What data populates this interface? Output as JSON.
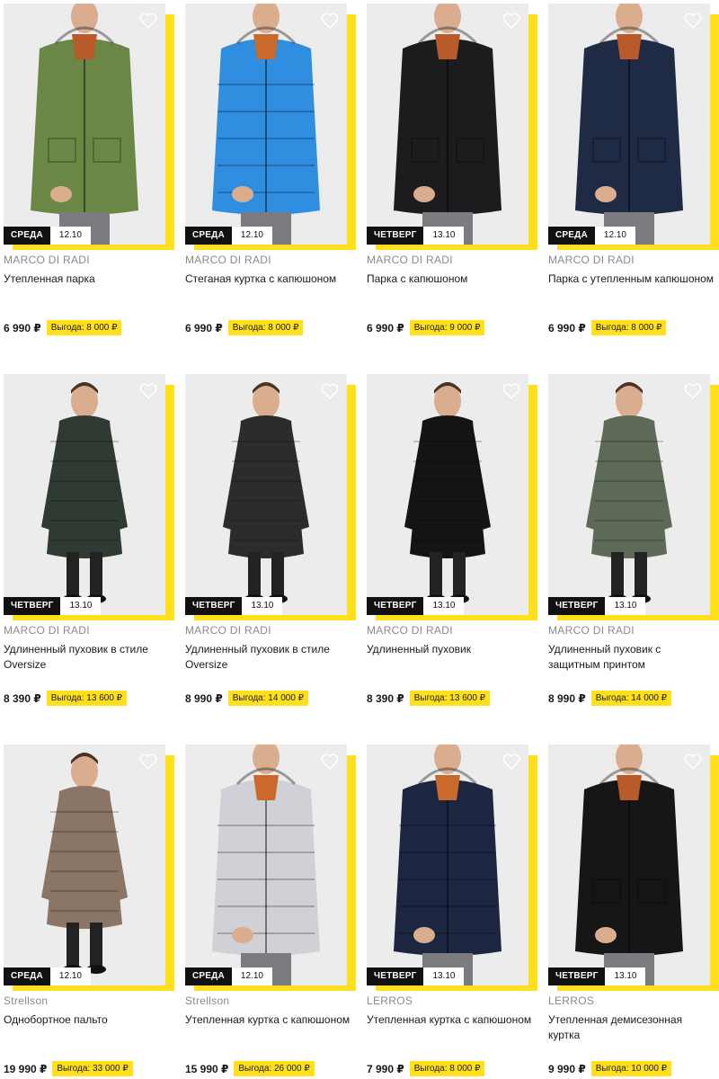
{
  "products": [
    {
      "brand": "MARCO DI RADI",
      "title": "Утепленная парка",
      "day": "СРЕДА",
      "date": "12.10",
      "price": "6 990 ₽",
      "benefit": "Выгода: 8 000 ₽",
      "coat_color": "#6b8745",
      "coat_shape": "parka"
    },
    {
      "brand": "MARCO DI RADI",
      "title": "Стеганая куртка с капюшоном",
      "day": "СРЕДА",
      "date": "12.10",
      "price": "6 990 ₽",
      "benefit": "Выгода: 8 000 ₽",
      "coat_color": "#2f8ee0",
      "coat_shape": "puffer"
    },
    {
      "brand": "MARCO DI RADI",
      "title": "Парка с капюшоном",
      "day": "ЧЕТВЕРГ",
      "date": "13.10",
      "price": "6 990 ₽",
      "benefit": "Выгода: 9 000 ₽",
      "coat_color": "#1c1c1e",
      "coat_shape": "parka"
    },
    {
      "brand": "MARCO DI RADI",
      "title": "Парка с утепленным капюшоном",
      "day": "СРЕДА",
      "date": "12.10",
      "price": "6 990 ₽",
      "benefit": "Выгода: 8 000 ₽",
      "coat_color": "#1f2a44",
      "coat_shape": "parka"
    },
    {
      "brand": "MARCO DI RADI",
      "title": "Удлиненный пуховик в стиле Oversize",
      "day": "ЧЕТВЕРГ",
      "date": "13.10",
      "price": "8 390 ₽",
      "benefit": "Выгода: 13 600 ₽",
      "coat_color": "#2f3a33",
      "coat_shape": "long"
    },
    {
      "brand": "MARCO DI RADI",
      "title": "Удлиненный пуховик в стиле Oversize",
      "day": "ЧЕТВЕРГ",
      "date": "13.10",
      "price": "8 990 ₽",
      "benefit": "Выгода: 14 000 ₽",
      "coat_color": "#2c2c2c",
      "coat_shape": "long"
    },
    {
      "brand": "MARCO DI RADI",
      "title": "Удлиненный пуховик",
      "day": "ЧЕТВЕРГ",
      "date": "13.10",
      "price": "8 390 ₽",
      "benefit": "Выгода: 13 600 ₽",
      "coat_color": "#141414",
      "coat_shape": "long"
    },
    {
      "brand": "MARCO DI RADI",
      "title": "Удлиненный пуховик с защитным принтом",
      "day": "ЧЕТВЕРГ",
      "date": "13.10",
      "price": "8 990 ₽",
      "benefit": "Выгода: 14 000 ₽",
      "coat_color": "#5e6a58",
      "coat_shape": "long"
    },
    {
      "brand": "Strellson",
      "title": "Однобортное пальто",
      "day": "СРЕДА",
      "date": "12.10",
      "price": "19 990 ₽",
      "benefit": "Выгода: 33 000 ₽",
      "coat_color": "#8a7566",
      "coat_shape": "overcoat"
    },
    {
      "brand": "Strellson",
      "title": "Утепленная куртка с капюшоном",
      "day": "СРЕДА",
      "date": "12.10",
      "price": "15 990 ₽",
      "benefit": "Выгода: 26 000 ₽",
      "coat_color": "#cfd1d6",
      "coat_shape": "puffer"
    },
    {
      "brand": "LERROS",
      "title": "Утепленная куртка с капюшоном",
      "day": "ЧЕТВЕРГ",
      "date": "13.10",
      "price": "7 990 ₽",
      "benefit": "Выгода: 8 000 ₽",
      "coat_color": "#1d2640",
      "coat_shape": "puffer"
    },
    {
      "brand": "LERROS",
      "title": "Утепленная демисезонная куртка",
      "day": "ЧЕТВЕРГ",
      "date": "13.10",
      "price": "9 990 ₽",
      "benefit": "Выгода: 10 000 ₽",
      "coat_color": "#161616",
      "coat_shape": "parka"
    }
  ],
  "icons": {
    "favorite": "heart-outline-icon"
  },
  "colors": {
    "accent": "#ffe01b",
    "tag_dark": "#111111",
    "brand_text": "#8a8a8a"
  }
}
